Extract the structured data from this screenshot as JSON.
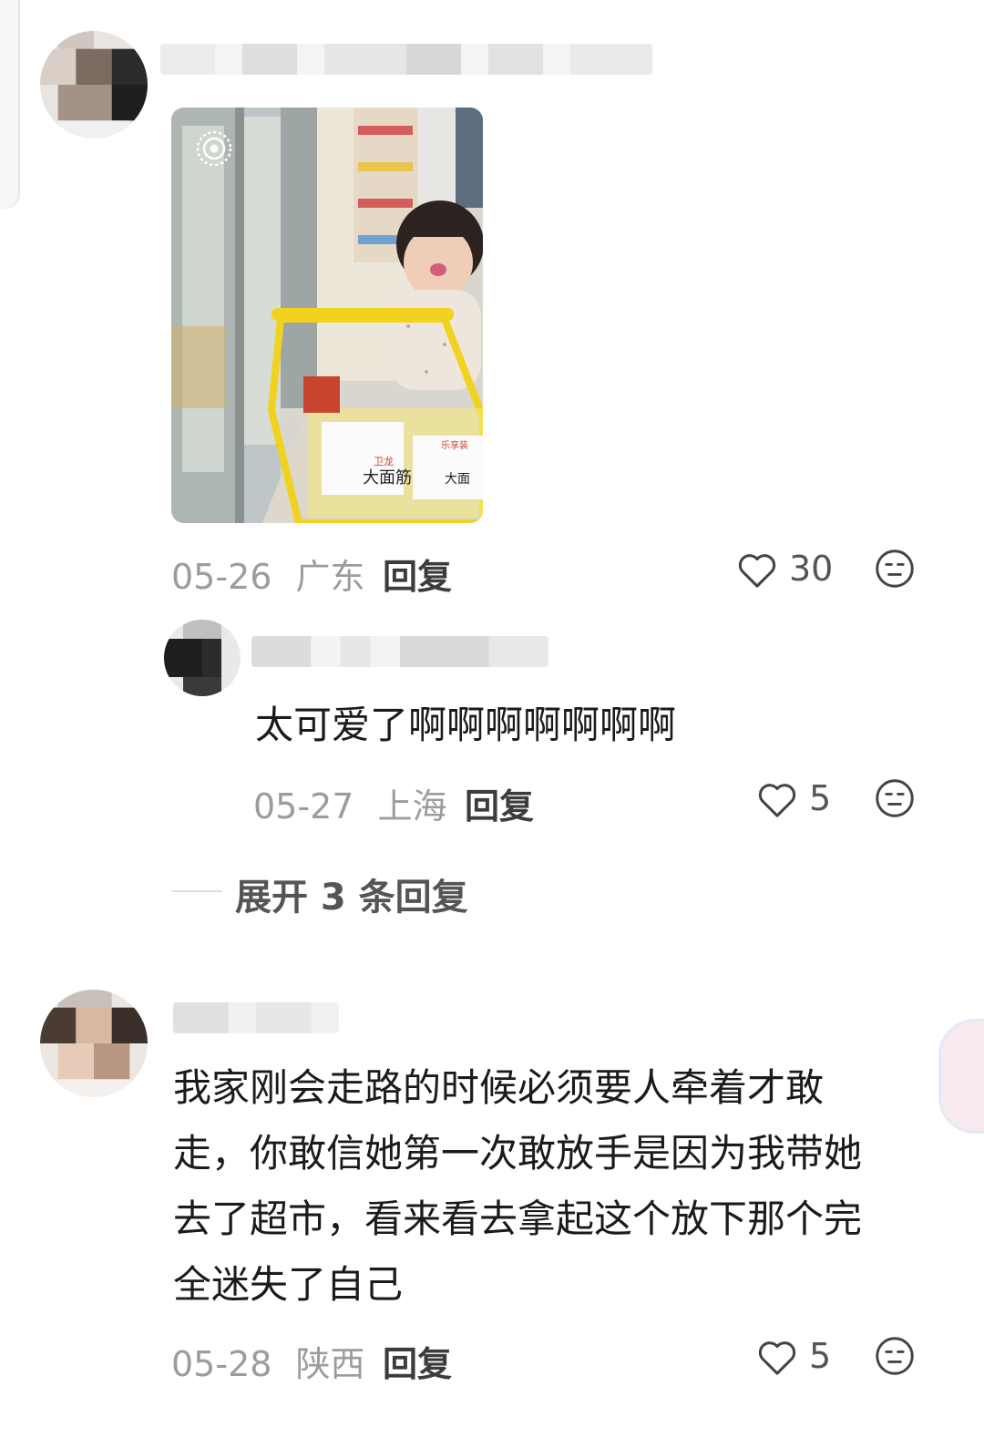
{
  "comments": [
    {
      "date": "05-26",
      "location": "广东",
      "reply_label": "回复",
      "likes": "30",
      "attached_image": "supermarket-child-cart-photo",
      "photo_text": {
        "product_1": "大面筋",
        "product_2": "大面",
        "brand": "卫龙",
        "brand_2": "乐享装"
      }
    },
    {
      "text": "太可爱了啊啊啊啊啊啊啊",
      "date": "05-27",
      "location": "上海",
      "reply_label": "回复",
      "likes": "5"
    },
    {
      "text_lines": [
        "我家刚会走路的时候必须要人牵着才敢",
        "走，你敢信她第一次敢放手是因为我带她",
        "去了超市，看来看去拿起这个放下那个完",
        "全迷失了自己"
      ],
      "date": "05-28",
      "location": "陕西",
      "reply_label": "回复",
      "likes": "5"
    }
  ],
  "expand_replies": {
    "label": "展开 3 条回复"
  },
  "icons": {
    "like": "heart-outline-icon",
    "reaction": "neutral-face-icon",
    "live_photo": "live-photo-icon"
  },
  "colors": {
    "meta": "#9c9c9c",
    "text": "#1b1b1b",
    "cart_yellow": "#f1d21e"
  }
}
